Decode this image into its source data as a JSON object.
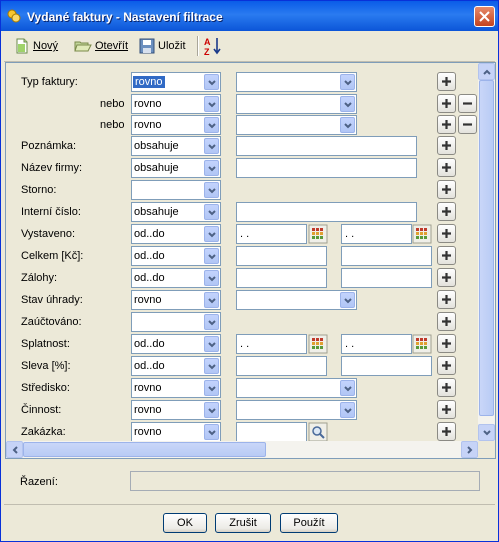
{
  "window": {
    "title": "Vydané faktury - Nastavení filtrace"
  },
  "toolbar": {
    "new_label": "Nový",
    "open_label": "Otevřít",
    "save_label": "Uložit",
    "sort_icon": "sort-az-icon"
  },
  "rows": [
    {
      "label": "Typ faktury:",
      "op": "rovno"
    },
    {
      "label": "nebo",
      "op": "rovno"
    },
    {
      "label": "nebo",
      "op": "rovno"
    },
    {
      "label": "Poznámka:",
      "op": "obsahuje"
    },
    {
      "label": "Název firmy:",
      "op": "obsahuje"
    },
    {
      "label": "Storno:",
      "op": ""
    },
    {
      "label": "Interní číslo:",
      "op": "obsahuje"
    },
    {
      "label": "Vystaveno:",
      "op": "od..do",
      "from": " .  .",
      "to": " .  ."
    },
    {
      "label": "Celkem [Kč]:",
      "op": "od..do"
    },
    {
      "label": "Zálohy:",
      "op": "od..do"
    },
    {
      "label": "Stav úhrady:",
      "op": "rovno"
    },
    {
      "label": "Zaúčtováno:",
      "op": ""
    },
    {
      "label": "Splatnost:",
      "op": "od..do",
      "from": " .  .",
      "to": " .  ."
    },
    {
      "label": "Sleva [%]:",
      "op": "od..do"
    },
    {
      "label": "Středisko:",
      "op": "rovno"
    },
    {
      "label": "Činnost:",
      "op": "rovno"
    },
    {
      "label": "Zakázka:",
      "op": "rovno"
    }
  ],
  "footer": {
    "razeni_label": "Řazení:",
    "ok": "OK",
    "cancel": "Zrušit",
    "apply": "Použít"
  },
  "colors": {
    "title_bar": "#0a5ce8",
    "selection": "#316ac5",
    "dialog_bg": "#ece9d8"
  }
}
